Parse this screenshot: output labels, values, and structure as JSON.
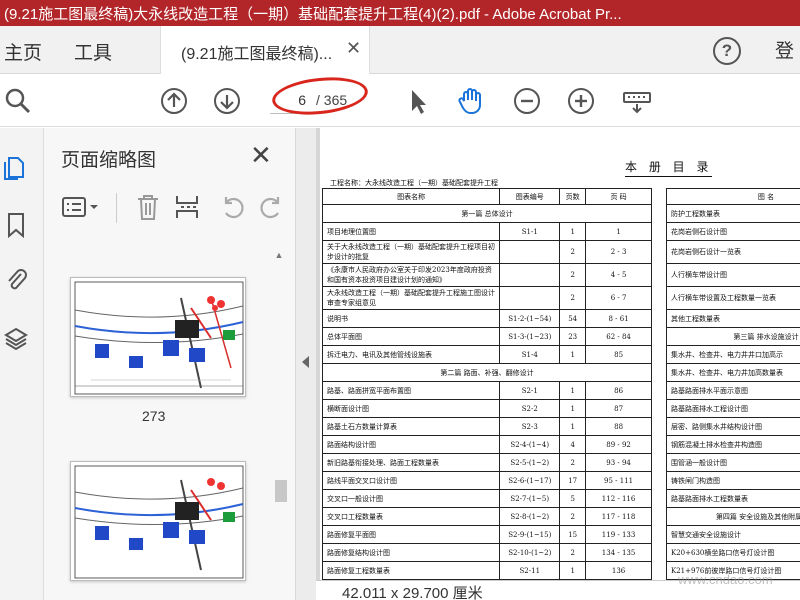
{
  "window": {
    "title": "(9.21施工图最终稿)大永线改造工程（一期）基础配套提升工程(4)(2).pdf - Adobe Acrobat Pr...",
    "watermark": "道客网"
  },
  "tabs": {
    "home": "主页",
    "tools": "工具",
    "document": "(9.21施工图最终稿)...",
    "login_partial": "登"
  },
  "toolbar": {
    "page_value": "6",
    "page_total": "/ 365"
  },
  "thumbnail_panel": {
    "title": "页面缩略图",
    "thumbnails": [
      {
        "label": "273"
      },
      {
        "label": ""
      }
    ]
  },
  "document": {
    "heading": "本 册 目 录",
    "project_line": "工程名称：大永线改造工程（一期）基础配套提升工程",
    "left_table": {
      "headers": [
        "图表名称",
        "图表编号",
        "页数",
        "页   码"
      ],
      "rows": [
        {
          "name": "第一篇  总体设计",
          "code": "",
          "pages": "",
          "range": "",
          "section": true
        },
        {
          "name": "项目地理位置图",
          "code": "S1-1",
          "pages": "1",
          "range": "1"
        },
        {
          "name": "关于大永线改造工程（一期）基础配套提升工程项目初步设计的批复",
          "code": "",
          "pages": "2",
          "range": "2  -  3"
        },
        {
          "name": "《永康市人民政府办公室关于印发2023年度政府投资和国有资本投资项目建设计划的通知》",
          "code": "",
          "pages": "2",
          "range": "4  -  5"
        },
        {
          "name": "大永线改造工程（一期）基础配套提升工程施工图设计审查专家组意见",
          "code": "",
          "pages": "2",
          "range": "6  -  7"
        },
        {
          "name": "说明书",
          "code": "S1-2-(1~54)",
          "pages": "54",
          "range": "8  -  61"
        },
        {
          "name": "总体平面图",
          "code": "S1-3-(1~23)",
          "pages": "23",
          "range": "62  -  84"
        },
        {
          "name": "拆迁电力、电讯及其他管线设施表",
          "code": "S1-4",
          "pages": "1",
          "range": "85"
        },
        {
          "name": "第二篇  路面、补强、翻修设计",
          "code": "",
          "pages": "",
          "range": "",
          "section": true
        },
        {
          "name": "路基、路面拼宽平面布置图",
          "code": "S2-1",
          "pages": "1",
          "range": "86"
        },
        {
          "name": "横断面设计图",
          "code": "S2-2",
          "pages": "1",
          "range": "87"
        },
        {
          "name": "路基土石方数量计算表",
          "code": "S2-3",
          "pages": "1",
          "range": "88"
        },
        {
          "name": "路面结构设计图",
          "code": "S2-4-(1~4)",
          "pages": "4",
          "range": "89  -  92"
        },
        {
          "name": "新旧路基衔接处理、路面工程数量表",
          "code": "S2-5-(1~2)",
          "pages": "2",
          "range": "93  -  94"
        },
        {
          "name": "路线平面交叉口设计图",
          "code": "S2-6-(1~17)",
          "pages": "17",
          "range": "95  -  111"
        },
        {
          "name": "交叉口一般设计图",
          "code": "S2-7-(1~5)",
          "pages": "5",
          "range": "112  -  116"
        },
        {
          "name": "交叉口工程数量表",
          "code": "S2-8-(1~2)",
          "pages": "2",
          "range": "117  -  118"
        },
        {
          "name": "路面修复平面图",
          "code": "S2-9-(1~15)",
          "pages": "15",
          "range": "119  -  133"
        },
        {
          "name": "路面修复结构设计图",
          "code": "S2-10-(1~2)",
          "pages": "2",
          "range": "134  -  135"
        },
        {
          "name": "路面修复工程数量表",
          "code": "S2-11",
          "pages": "1",
          "range": "136"
        }
      ]
    },
    "right_table": {
      "header": "图             名",
      "rows": [
        {
          "name": "防护工程数量表"
        },
        {
          "name": "花岗岩侧石设计图"
        },
        {
          "name": "花岗岩侧石设计一览表"
        },
        {
          "name": "人行横车带设计图"
        },
        {
          "name": "人行横车带设置及工程数量一览表"
        },
        {
          "name": "其他工程数量表"
        },
        {
          "name": "第三篇  排水设施设计",
          "section": true
        },
        {
          "name": "集水井、检查井、电力井井口加高示"
        },
        {
          "name": "集水井、检查井、电力井加高数量表"
        },
        {
          "name": "路基路面排水平面示意图"
        },
        {
          "name": "路基路面排水工程设计图"
        },
        {
          "name": "层密、路侧集水井结构设计图"
        },
        {
          "name": "钢筋混凝土排水检查井构造图"
        },
        {
          "name": "围管涵一般设计图"
        },
        {
          "name": "铸铁闸门构造图"
        },
        {
          "name": "路基路面排水工程数量表"
        },
        {
          "name": "第四篇  安全设施及其他附属工程",
          "section": true
        },
        {
          "name": "智慧交通安全设施设计"
        },
        {
          "name": "K20+630横坐路口信号灯设计图"
        },
        {
          "name": "K21+976前彼岸路口信号灯设计图"
        }
      ]
    }
  },
  "statusbar": {
    "dimensions": "42.011 x 29.700 厘米"
  },
  "site_watermark": "www.cndao.com"
}
